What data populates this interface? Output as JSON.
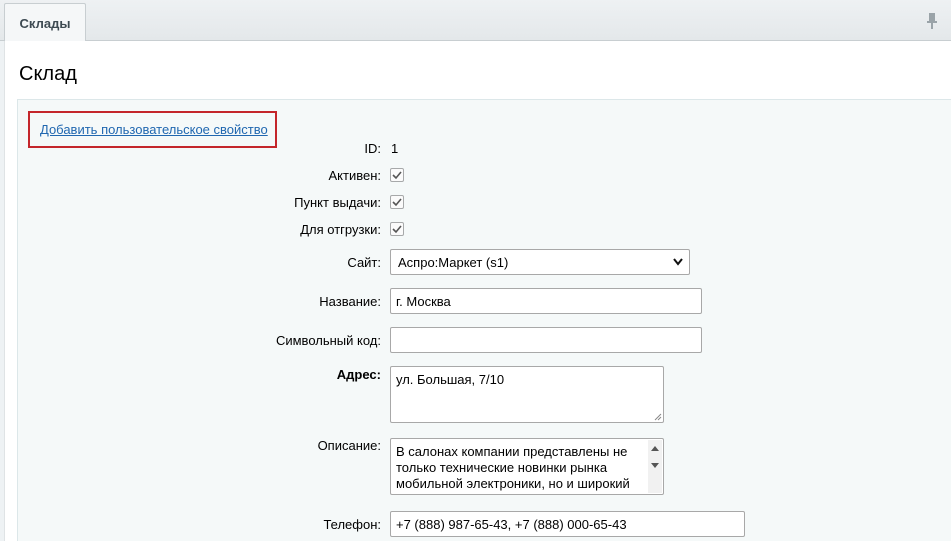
{
  "tabs": [
    {
      "label": "Склады"
    }
  ],
  "page": {
    "title": "Склад"
  },
  "form": {
    "add_property_link": "Добавить пользовательское свойство",
    "id": {
      "label": "ID:",
      "value": "1"
    },
    "active": {
      "label": "Активен:",
      "checked": true
    },
    "pickup": {
      "label": "Пункт выдачи:",
      "checked": true
    },
    "shipping": {
      "label": "Для отгрузки:",
      "checked": true
    },
    "site": {
      "label": "Сайт:",
      "selected": "Аспро:Маркет (s1)"
    },
    "name": {
      "label": "Название:",
      "value": "г. Москва"
    },
    "code": {
      "label": "Символьный код:",
      "value": ""
    },
    "address": {
      "label": "Адрес:",
      "value": "ул. Большая, 7/10"
    },
    "description": {
      "label": "Описание:",
      "value": "В салонах компании представлены не только технические новинки рынка мобильной электроники, но и широкий"
    },
    "phone": {
      "label": "Телефон:",
      "value": "+7 (888) 987-65-43, +7 (888) 000-65-43"
    }
  },
  "icons": {
    "pin": "pin-icon",
    "check": "checkmark-icon",
    "chevron": "chevron-down-icon"
  },
  "colors": {
    "link": "#2067b0",
    "highlight_border": "#c4262b"
  }
}
